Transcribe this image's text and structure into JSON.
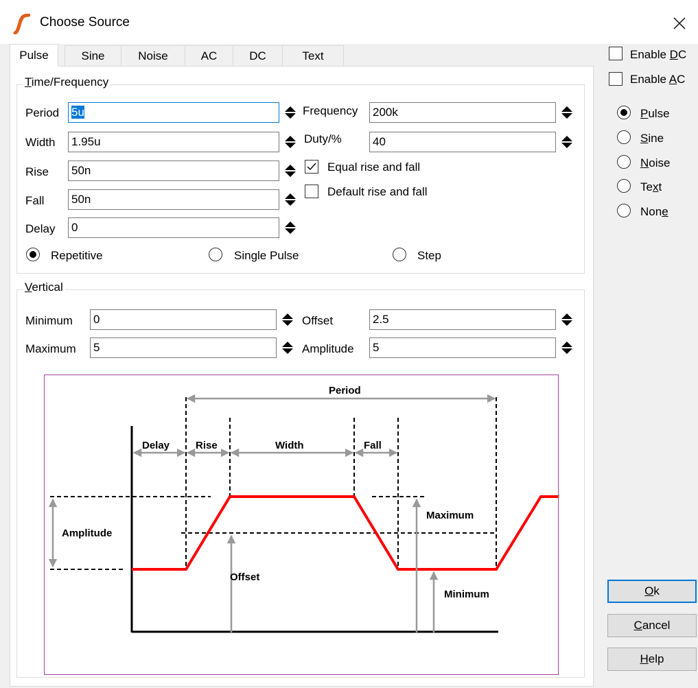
{
  "window": {
    "title": "Choose Source"
  },
  "tabs": [
    {
      "label": "Pulse",
      "active": true
    },
    {
      "label": "Sine",
      "active": false
    },
    {
      "label": "Noise",
      "active": false
    },
    {
      "label": "AC",
      "active": false
    },
    {
      "label": "DC",
      "active": false
    },
    {
      "label": "Text",
      "active": false
    }
  ],
  "time_group": {
    "label_prefix": "T",
    "label_rest": "ime/Frequency",
    "period": {
      "label": "Period",
      "value": "5u"
    },
    "width": {
      "label": "Width",
      "value": "1.95u"
    },
    "rise": {
      "label": "Rise",
      "value": "50n"
    },
    "fall": {
      "label": "Fall",
      "value": "50n"
    },
    "delay": {
      "label": "Delay",
      "value": "0"
    },
    "frequency": {
      "label": "Frequency",
      "value": "200k"
    },
    "duty": {
      "label": "Duty/%",
      "value": "40"
    },
    "equal_rise_fall": {
      "label": "Equal rise and fall",
      "checked": true
    },
    "default_rise_fall": {
      "label": "Default rise and fall",
      "checked": false
    },
    "mode": {
      "repetitive": "Repetitive",
      "single_pulse": "Single Pulse",
      "step": "Step",
      "selected": "Repetitive"
    }
  },
  "vertical_group": {
    "label_prefix": "V",
    "label_rest": "ertical",
    "minimum": {
      "label": "Minimum",
      "value": "0"
    },
    "maximum": {
      "label": "Maximum",
      "value": "5"
    },
    "offset": {
      "label": "Offset",
      "value": "2.5"
    },
    "amplitude": {
      "label": "Amplitude",
      "value": "5"
    }
  },
  "right_panel": {
    "enable_dc": {
      "pre": "Enable ",
      "key": "D",
      "post": "C",
      "checked": false
    },
    "enable_ac": {
      "pre": "Enable ",
      "key": "A",
      "post": "C",
      "checked": false
    },
    "radios": [
      {
        "pre": "",
        "key": "P",
        "post": "ulse",
        "selected": true
      },
      {
        "pre": "",
        "key": "S",
        "post": "ine",
        "selected": false
      },
      {
        "pre": "",
        "key": "N",
        "post": "oise",
        "selected": false
      },
      {
        "pre": "Te",
        "key": "x",
        "post": "t",
        "selected": false
      },
      {
        "pre": "Non",
        "key": "e",
        "post": "",
        "selected": false
      }
    ]
  },
  "buttons": {
    "ok": {
      "key": "O",
      "post": "k"
    },
    "cancel": {
      "key": "C",
      "post": "ancel"
    },
    "help": {
      "key": "H",
      "post": "elp"
    }
  },
  "diagram": {
    "labels": {
      "period": "Period",
      "delay": "Delay",
      "rise": "Rise",
      "width": "Width",
      "fall": "Fall",
      "amplitude": "Amplitude",
      "maximum": "Maximum",
      "offset": "Offset",
      "minimum": "Minimum"
    },
    "colors": {
      "waveform": "#ff0000",
      "frame": "#a040a0",
      "arrows": "#999999"
    }
  }
}
